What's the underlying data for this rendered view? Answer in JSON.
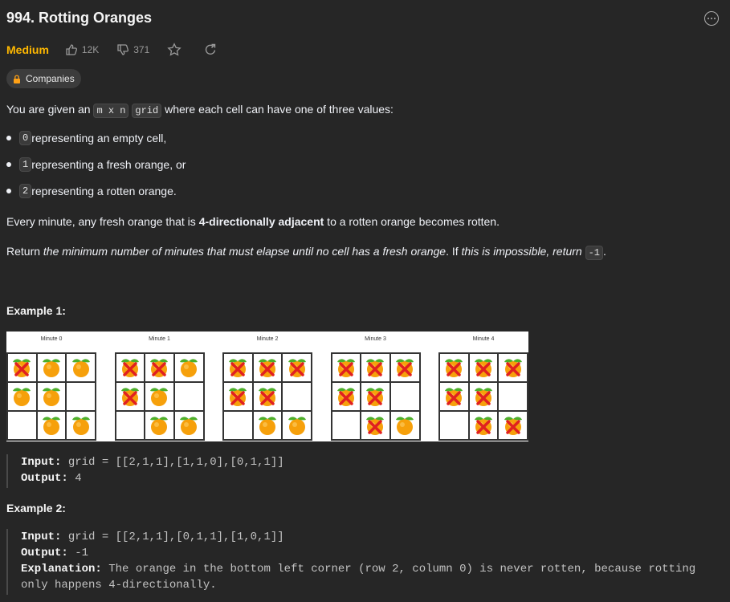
{
  "problem": {
    "title": "994. Rotting Oranges",
    "difficulty": "Medium",
    "likes": "12K",
    "dislikes": "371",
    "companies_label": "Companies"
  },
  "description": {
    "intro_pre": "You are given an ",
    "intro_code1": "m x n",
    "intro_code2": "grid",
    "intro_post": " where each cell can have one of three values:",
    "bullets": [
      {
        "code": "0",
        "text": " representing an empty cell,"
      },
      {
        "code": "1",
        "text": " representing a fresh orange, or"
      },
      {
        "code": "2",
        "text": " representing a rotten orange."
      }
    ],
    "p2_pre": "Every minute, any fresh orange that is ",
    "p2_bold": "4-directionally adjacent",
    "p2_post": " to a rotten orange becomes rotten.",
    "p3_pre": "Return ",
    "p3_italic": "the minimum number of minutes that must elapse until no cell has a fresh orange",
    "p3_mid": ". If ",
    "p3_italic2": "this is impossible, return",
    "p3_code": "-1",
    "p3_post": "."
  },
  "example1": {
    "heading": "Example 1:",
    "minutes": [
      "Minute 0",
      "Minute 1",
      "Minute 2",
      "Minute 3",
      "Minute 4"
    ],
    "grids": [
      [
        2,
        1,
        1,
        1,
        1,
        0,
        0,
        1,
        1
      ],
      [
        2,
        2,
        1,
        2,
        1,
        0,
        0,
        1,
        1
      ],
      [
        2,
        2,
        2,
        2,
        2,
        0,
        0,
        1,
        1
      ],
      [
        2,
        2,
        2,
        2,
        2,
        0,
        0,
        2,
        1
      ],
      [
        2,
        2,
        2,
        2,
        2,
        0,
        0,
        2,
        2
      ]
    ],
    "input_label": "Input:",
    "input_value": " grid = [[2,1,1],[1,1,0],[0,1,1]]",
    "output_label": "Output:",
    "output_value": " 4"
  },
  "example2": {
    "heading": "Example 2:",
    "input_label": "Input:",
    "input_value": " grid = [[2,1,1],[0,1,1],[1,0,1]]",
    "output_label": "Output:",
    "output_value": " -1",
    "explanation_label": "Explanation:",
    "explanation_line1": " The orange in the bottom left corner (row 2, column 0) is never rotten, because rotting",
    "explanation_line2": "only happens 4-directionally."
  },
  "icons": {
    "more": "more-options-icon",
    "like": "thumbs-up-icon",
    "dislike": "thumbs-down-icon",
    "star": "star-icon",
    "share": "share-icon",
    "lock": "lock-icon"
  },
  "colors": {
    "background": "#262626",
    "difficulty": "#ffb800",
    "lock": "#ffa116"
  }
}
